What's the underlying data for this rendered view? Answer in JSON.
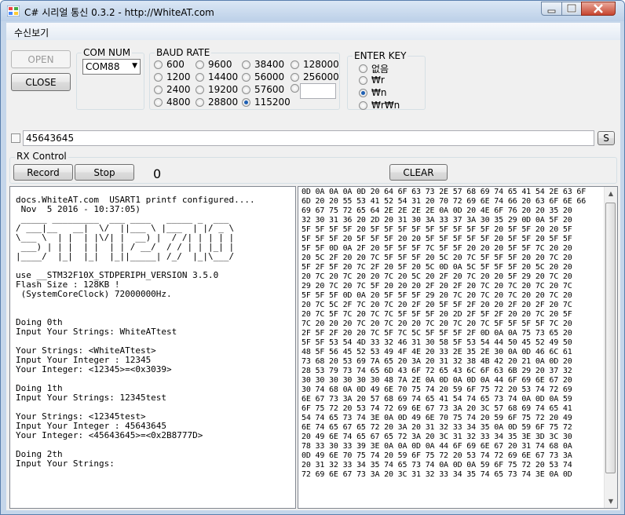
{
  "window": {
    "title": "C# 시리얼 통신 0.3.2 - http://WhiteAT.com"
  },
  "menu": {
    "items": [
      "수신보기"
    ]
  },
  "connect": {
    "open_label": "OPEN",
    "close_label": "CLOSE"
  },
  "com": {
    "title": "COM NUM",
    "selected": "COM88"
  },
  "baud": {
    "title": "BAUD RATE",
    "options": [
      "600",
      "1200",
      "2400",
      "4800",
      "9600",
      "14400",
      "19200",
      "28800",
      "38400",
      "56000",
      "57600",
      "115200",
      "128000",
      "256000"
    ],
    "selected": "115200",
    "custom_value": ""
  },
  "enter_key": {
    "title": "ENTER KEY",
    "options": [
      "없음",
      "₩r",
      "₩n",
      "₩r₩n"
    ],
    "selected": "₩n"
  },
  "send": {
    "value": "45643645",
    "send_label": "S",
    "checked": false
  },
  "rx": {
    "title": "RX Control",
    "record_label": "Record",
    "stop_label": "Stop",
    "count": "0",
    "clear_label": "CLEAR"
  },
  "console": {
    "text": "docs.WhiteAT.com  USART1 printf configured....\n Nov  5 2016 - 10:37:05)\n _____ _________  ___ ____   _____ _  ___\n/ ___|__   __|  \\/  ||___ \\ |___  | |/ _ \\\n\\___ \\  | |  | |\\/| |  __) |  / /| | | | |\n ___) | | |  | |  | | / __/  / / | | |_| |\n|____/  |_|  |_|  |_||_____| /_/  |_|\\___/\n\nuse __STM32F10X_STDPERIPH_VERSION 3.5.0\nFlash Size : 128KB !\n (SystemCoreClock) 72000000Hz.\n\n\nDoing 0th\nInput Your Strings: WhiteATtest\n\nYour Strings: <WhiteATtest>\nInput Your Integer : 12345\nYour Integer: <12345>=<0x3039>\n\nDoing 1th\nInput Your Strings: 12345test\n\nYour Strings: <12345test>\nInput Your Integer : 45643645\nYour Integer: <45643645>=<0x2B8777D>\n\nDoing 2th\nInput Your Strings:"
  },
  "hex": {
    "text": "0D 0A 0A 0A 0D 20 64 6F 63 73 2E 57 68 69 74 65 41 54 2E 63 6F\n6D 20 20 55 53 41 52 54 31 20 70 72 69 6E 74 66 20 63 6F 6E 66\n69 67 75 72 65 64 2E 2E 2E 2E 0A 0D 20 4E 6F 76 20 20 35 20\n32 30 31 36 20 2D 20 31 30 3A 33 37 3A 30 35 29 0D 0A 5F 20\n5F 5F 5F 5F 20 5F 5F 5F 5F 5F 5F 5F 5F 5F 20 5F 5F 20 20 5F\n5F 5F 5F 20 5F 5F 5F 20 20 5F 5F 5F 5F 5F 20 5F 5F 20 5F 5F\n5F 5F 0D 0A 2F 20 5F 5F 5F 7C 5F 5F 20 20 20 5F 5F 7C 20 20\n20 5C 2F 20 20 7C 5F 5F 5F 20 5C 20 7C 5F 5F 5F 20 20 7C 20\n5F 2F 5F 20 7C 2F 20 5F 20 5C 0D 0A 5C 5F 5F 5F 20 5C 20 20\n20 7C 20 7C 20 20 7C 20 5C 20 2F 20 7C 20 20 5F 29 20 7C 20\n29 20 7C 20 7C 5F 20 20 20 2F 20 2F 20 7C 20 7C 20 7C 20 7C\n5F 5F 5F 0D 0A 20 5F 5F 5F 29 20 7C 20 7C 20 7C 20 20 7C 20\n20 7C 5C 2F 7C 20 7C 20 2F 20 5F 5F 2F 20 20 2F 20 2F 20 7C\n20 7C 5F 7C 20 7C 7C 5F 5F 5F 20 2D 2F 5F 2F 20 20 7C 20 5F\n7C 20 20 20 7C 20 7C 20 20 7C 20 7C 20 7C 5F 5F 5F 5F 7C 20\n2F 5F 2F 20 20 7C 5F 7C 5C 5F 5F 5F 2F 0D 0A 0A 75 73 65 20\n5F 5F 53 54 4D 33 32 46 31 30 58 5F 53 54 44 50 45 52 49 50\n48 5F 56 45 52 53 49 4F 4E 20 33 2E 35 2E 30 0A 0D 46 6C 61\n73 68 20 53 69 7A 65 20 3A 20 31 32 38 4B 42 20 21 0A 0D 20\n28 53 79 73 74 65 6D 43 6F 72 65 43 6C 6F 63 6B 29 20 37 32\n30 30 30 30 30 30 48 7A 2E 0A 0D 0A 0D 0A 44 6F 69 6E 67 20\n30 74 68 0A 0D 49 6E 70 75 74 20 59 6F 75 72 20 53 74 72 69\n6E 67 73 3A 20 57 68 69 74 65 41 54 74 65 73 74 0A 0D 0A 59\n6F 75 72 20 53 74 72 69 6E 67 73 3A 20 3C 57 68 69 74 65 41\n54 74 65 73 74 3E 0A 0D 49 6E 70 75 74 20 59 6F 75 72 20 49\n6E 74 65 67 65 72 20 3A 20 31 32 33 34 35 0A 0D 59 6F 75 72\n20 49 6E 74 65 67 65 72 3A 20 3C 31 32 33 34 35 3E 3D 3C 30\n78 33 30 33 39 3E 0A 0A 0D 0A 44 6F 69 6E 67 20 31 74 68 0A\n0D 49 6E 70 75 74 20 59 6F 75 72 20 53 74 72 69 6E 67 73 3A\n20 31 32 33 34 35 74 65 73 74 0A 0D 0A 59 6F 75 72 20 53 74\n72 69 6E 67 73 3A 20 3C 31 32 33 34 35 74 65 73 74 3E 0A 0D"
  },
  "colors": {
    "accent": "#1d5fb3",
    "close_button": "#c7452f"
  }
}
